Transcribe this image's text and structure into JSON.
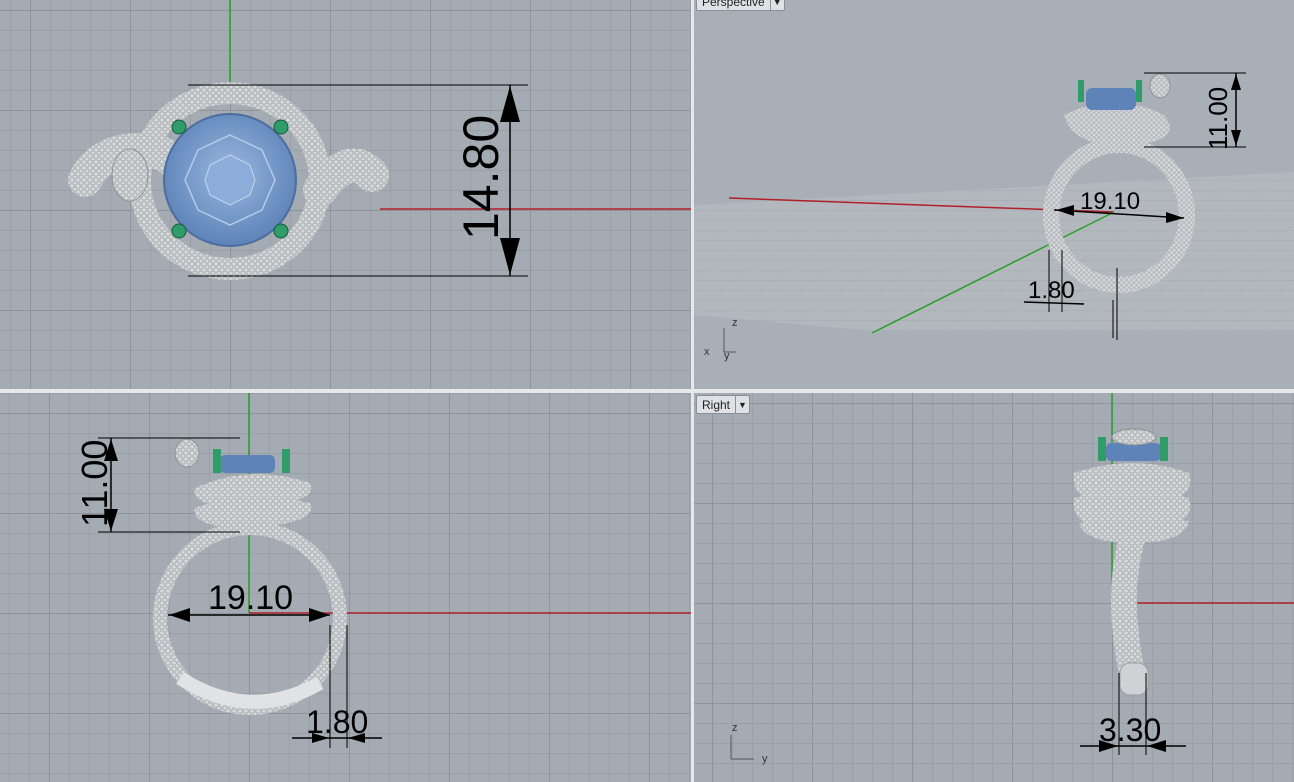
{
  "viewports": {
    "top": {
      "dims": {
        "height": "14.80"
      }
    },
    "perspective": {
      "label": "Perspective",
      "dims": {
        "height": "11.00",
        "diameter": "19.10",
        "thickness": "1.80"
      }
    },
    "front": {
      "dims": {
        "height": "11.00",
        "diameter": "19.10",
        "thickness": "1.80"
      }
    },
    "right": {
      "label": "Right",
      "dims": {
        "width": "3.30"
      }
    }
  },
  "axis_labels": {
    "x": "x",
    "y": "y",
    "z": "z"
  },
  "colors": {
    "viewport_bg": "#a5abb2",
    "grid_major": "#8e949b",
    "x_axis": "#b0202a",
    "y_axis": "#2aa02a",
    "metal": "#d9dbdd",
    "gem": "#6f95c9",
    "prongs": "#2f9c6a"
  },
  "icons": [
    "dropdown-arrow-icon"
  ]
}
